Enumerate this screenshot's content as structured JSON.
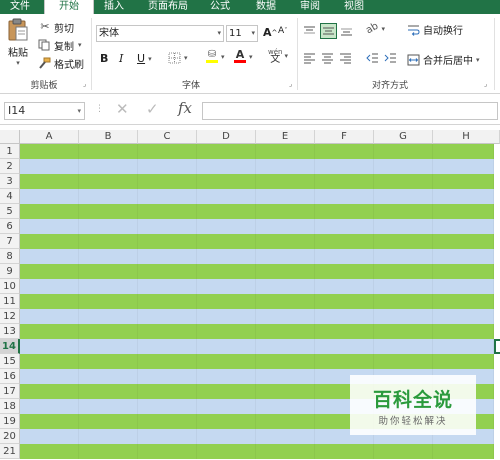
{
  "tabs": [
    "文件",
    "开始",
    "插入",
    "页面布局",
    "公式",
    "数据",
    "审阅",
    "视图"
  ],
  "active_tab": "开始",
  "colors": {
    "accent": "#217346",
    "band_green": "#92d050",
    "band_blue": "#c5d9f1",
    "align_active": "#c8e6c9"
  },
  "ribbon": {
    "clipboard": {
      "paste": "粘贴",
      "cut": "剪切",
      "copy": "复制",
      "format_painter": "格式刷",
      "label": "剪贴板"
    },
    "font": {
      "font_name": "宋体",
      "font_size": "11",
      "bold": "B",
      "italic": "I",
      "underline": "U",
      "grow": "A",
      "shrink": "A",
      "fill_color": "#ffff00",
      "font_color": "#ff0000",
      "label": "字体"
    },
    "alignment": {
      "wrap_text": "自动换行",
      "merge_center": "合并后居中",
      "label": "对齐方式"
    }
  },
  "formula_bar": {
    "name_box": "I14",
    "fx": "fx",
    "formula": ""
  },
  "grid": {
    "columns": [
      "A",
      "B",
      "C",
      "D",
      "E",
      "F",
      "G",
      "H"
    ],
    "rows": [
      "1",
      "2",
      "3",
      "4",
      "5",
      "6",
      "7",
      "8",
      "9",
      "10",
      "11",
      "12",
      "13",
      "14",
      "15",
      "16",
      "17",
      "18",
      "19",
      "20",
      "21"
    ],
    "active_row": "14",
    "banding": "odd rows green, even rows blue"
  },
  "watermark": {
    "title": "百科全说",
    "subtitle": "助你轻松解决"
  }
}
